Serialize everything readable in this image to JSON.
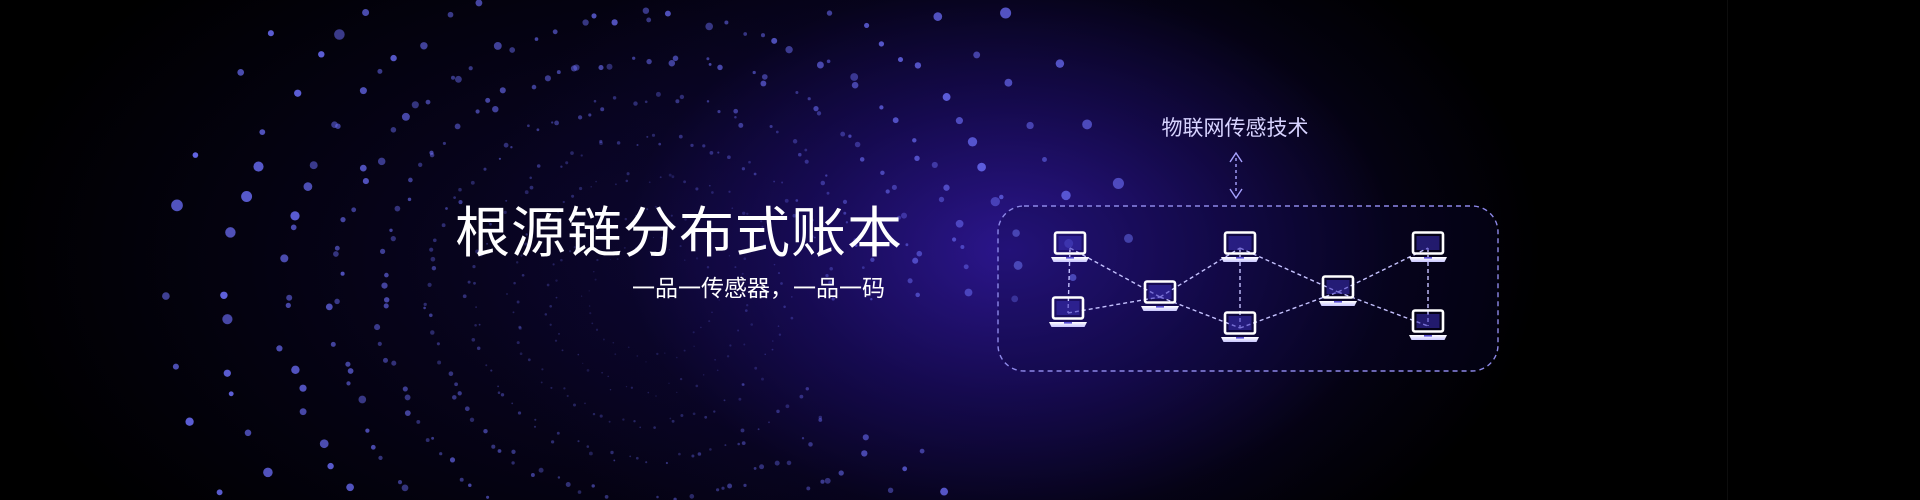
{
  "banner": {
    "title": "根源链分布式账本",
    "subtitle": "一品一传感器，一品一码",
    "iot_label": "物联网传感技术"
  },
  "icons": {
    "device": "laptop-icon",
    "connector": "double-arrow-icon"
  },
  "colors": {
    "glow": "#341aa8",
    "dot": "#6a6cf4",
    "dashed_line": "#b8b4ff",
    "text": "#ffffff",
    "label_text": "#d7d3ff"
  }
}
